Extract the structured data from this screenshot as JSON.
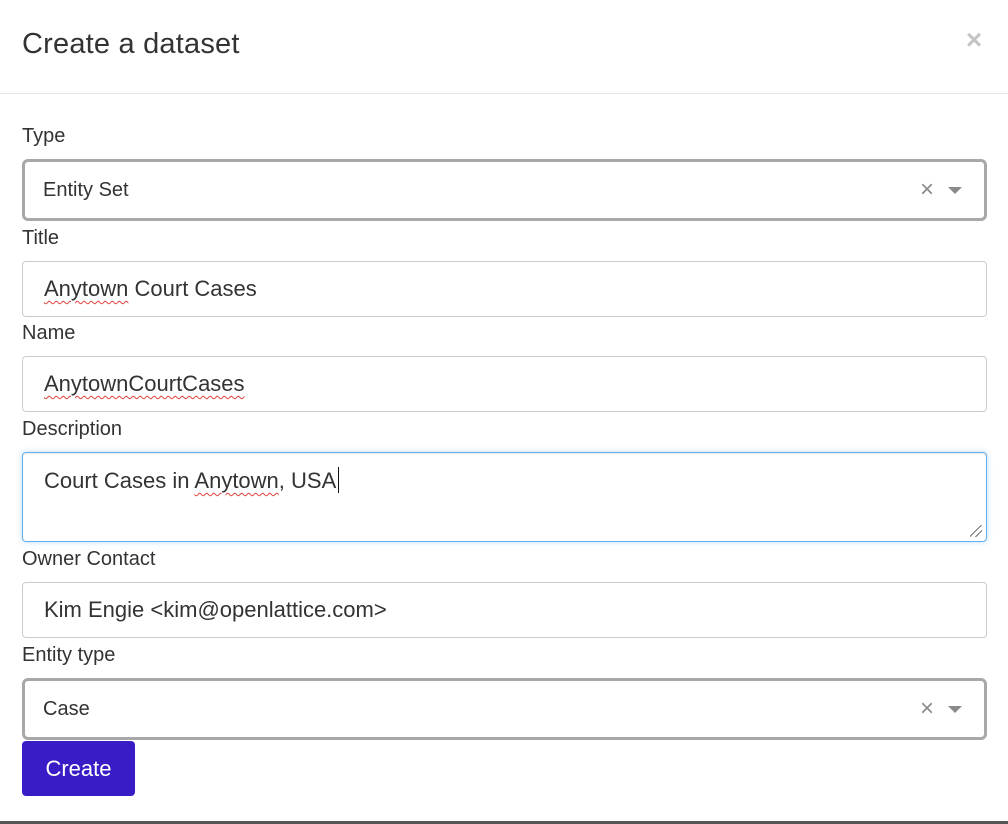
{
  "modal": {
    "title": "Create a dataset",
    "close_label": "×"
  },
  "form": {
    "type": {
      "label": "Type",
      "selected": "Entity Set"
    },
    "title": {
      "label": "Title",
      "value_part1": "Anytown",
      "value_part2": " Court Cases"
    },
    "name": {
      "label": "Name",
      "value": "AnytownCourtCases"
    },
    "description": {
      "label": "Description",
      "value_part1": "Court Cases in ",
      "value_part2": "Anytown",
      "value_part3": ", USA"
    },
    "owner_contact": {
      "label": "Owner Contact",
      "value": "Kim Engie <kim@openlattice.com>"
    },
    "entity_type": {
      "label": "Entity type",
      "selected": "Case"
    },
    "clear_symbol": "×",
    "submit_label": "Create"
  },
  "colors": {
    "primary_button": "#3a1cc7",
    "focus_border": "#66afe9",
    "spell_error": "#e0433a"
  }
}
